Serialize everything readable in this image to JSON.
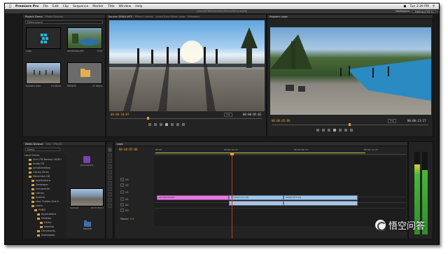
{
  "menubar": {
    "apple": "",
    "app": "Premiere Pro",
    "items": [
      "File",
      "Edit",
      "Clip",
      "Sequence",
      "Marker",
      "Title",
      "Window",
      "Help"
    ],
    "clock": "Tue 3:29 PM"
  },
  "titlebar": {
    "path": "/Users/FONG/Desktop/Demo/Demo.prproj"
  },
  "workspace": {
    "label": "Workspace:",
    "value": "Editing (CS5.5)"
  },
  "project": {
    "tabs": [
      "Project: Demo",
      "Media Browser"
    ],
    "file": "Demo.prproj",
    "items": [
      {
        "name": "yoga",
        "meta": ""
      },
      {
        "name": "aerialshots.JPG",
        "meta": "5:00"
      },
      {
        "name": "tumble1.mov",
        "meta": "15:36:01"
      },
      {
        "name": "PRIVATE",
        "meta": "27 Items"
      }
    ]
  },
  "source": {
    "tabs": [
      "Source: 00004.MTS",
      "Effect Controls",
      "Audio Track Mixer: yoga",
      "Metadata"
    ],
    "timecode_in": "00:00:10:07",
    "timecode_dur": "00:00:05:02",
    "fit": "Full"
  },
  "program": {
    "tab": "Program: yoga",
    "timecode_in": "00:00:05:08",
    "timecode_dur": "00:00:13:17",
    "fit": "Full"
  },
  "media_browser": {
    "tabs": [
      "Media Browser",
      "Info",
      "Effects"
    ],
    "drive": "Demo",
    "tree": [
      "Local Drives",
      "2nd 1TB Backup VIDEO",
      "Audio CD",
      "JumpDriveBox",
      "Library Drive",
      "Macintosh HD",
      "Applications",
      "Developer",
      "Documents",
      "Library",
      "System",
      "User Guides And In",
      "Users",
      "FONG",
      "Applications",
      "Desktop",
      "Demo",
      "desktop",
      "Documents",
      "Downloads"
    ],
    "files": [
      {
        "name": "Demo.prproj",
        "meta": ""
      },
      {
        "name": "tumble1",
        "meta": "00:15:36:01"
      },
      {
        "name": "PRIVATE",
        "meta": ""
      }
    ]
  },
  "timeline": {
    "tab": "yoga",
    "timecode": "00:00:05:08",
    "ruler": [
      "00:00",
      "00:00:04:23",
      "00:00:09:23",
      "00:00:14:23"
    ],
    "tracks": [
      {
        "name": "V3"
      },
      {
        "name": "V2"
      },
      {
        "name": "V1"
      },
      {
        "name": "A1"
      },
      {
        "name": "A2"
      },
      {
        "name": "A3"
      },
      {
        "name": "Master"
      }
    ],
    "master_value": "0.0",
    "clips_video": [
      {
        "label": "aerialshots.JPG",
        "color": "#e57be0"
      },
      {
        "label": "tumble1.mov [V]",
        "color": "#9ec7ea"
      },
      {
        "label": "00004.MTS [V]",
        "color": "#9ec7ea"
      }
    ],
    "clips_audio": [
      {
        "label": "",
        "color": "#a9c4e4"
      },
      {
        "label": "",
        "color": "#a9c4e4"
      }
    ]
  },
  "watermark": {
    "text": "悟空问答"
  },
  "colors": {
    "accent_timecode": "#e8a32b",
    "playhead": "#d03030",
    "video_clip": "#9ec7ea",
    "still_clip": "#e57be0"
  }
}
